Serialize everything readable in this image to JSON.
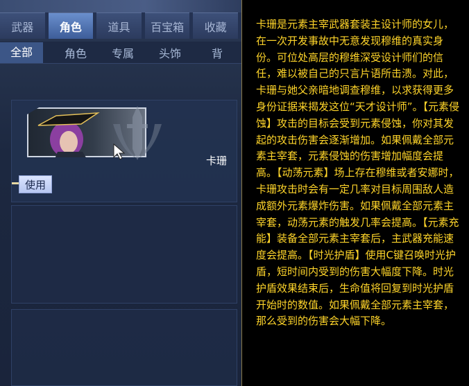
{
  "tabs": [
    {
      "label": "武器"
    },
    {
      "label": "角色"
    },
    {
      "label": "道具"
    },
    {
      "label": "百宝箱"
    },
    {
      "label": "收藏"
    }
  ],
  "subtabs": [
    {
      "label": "全部"
    },
    {
      "label": "角色"
    },
    {
      "label": "专属"
    },
    {
      "label": "头饰"
    },
    {
      "label": "背"
    }
  ],
  "item": {
    "name": "卡珊",
    "use_label": "使用"
  },
  "tooltip": {
    "text": "卡珊是元素主宰武器套装主设计师的女儿，在一次开发事故中无意发现穆维的真实身份。可位处高层的穆维深受设计师们的信任，难以被自己的只言片语所击溃。对此，卡珊与她父亲暗地调查穆维，以求获得更多身份证据来揭发这位“天才设计师”。【元素侵蚀】攻击的目标会受到元素侵蚀，你对其发起的攻击伤害会逐渐增加。如果佩戴全部元素主宰套，元素侵蚀的伤害增加幅度会提高。【动荡元素】场上存在穆维或者安娜时，卡珊攻击时会有一定几率对目标周围敌人造成额外元素爆炸伤害。如果佩戴全部元素主宰套，动荡元素的触发几率会提高。【元素充能】装备全部元素主宰套后，主武器充能速度会提高。【时光护盾】使用C键召唤时光护盾，短时间内受到的伤害大幅度下降。时光护盾效果结束后，生命值将回复到时光护盾开始时的数值。如果佩戴全部元素主宰套，那么受到的伤害会大幅下降。",
    "color": "#ffd52a"
  }
}
